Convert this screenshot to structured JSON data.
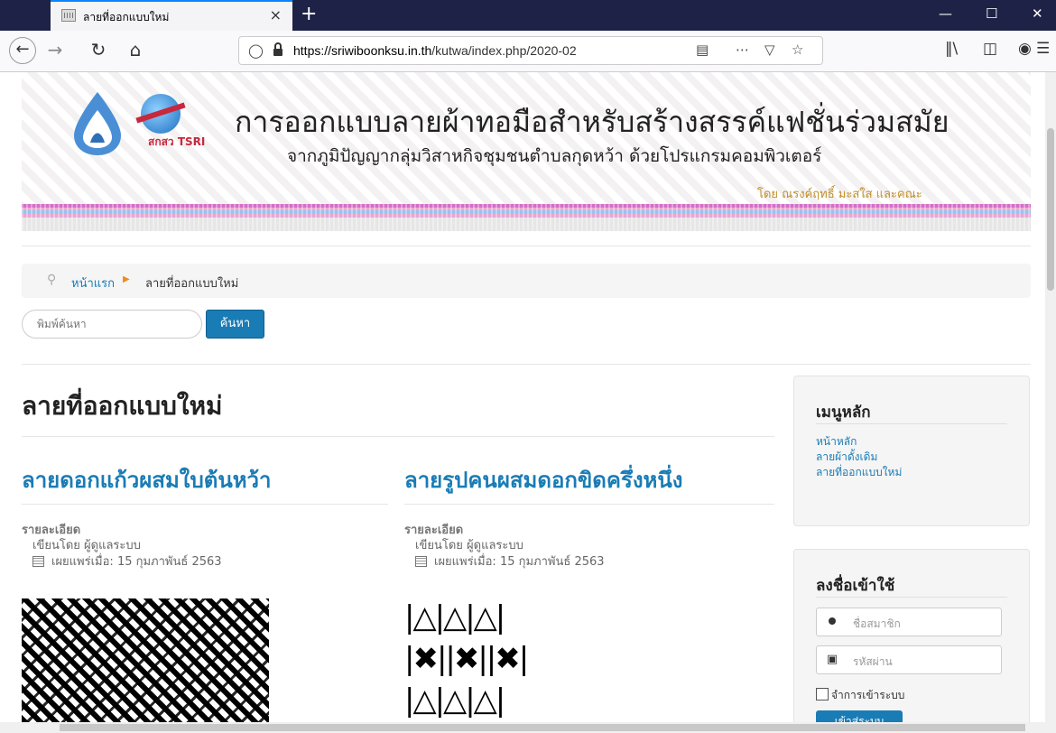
{
  "browser": {
    "tab_title": "ลายที่ออกแบบใหม่",
    "tab_close": "×",
    "new_tab": "+",
    "url_host": "https://sriwiboonksu.in.th",
    "url_path": "/kutwa/index.php/2020-02",
    "icons": [
      "back-icon",
      "forward-icon",
      "reload-icon",
      "home-icon",
      "shield-icon",
      "lock-icon",
      "reader-view-icon",
      "more-icon",
      "pocket-icon",
      "star-icon",
      "library-icon",
      "sidebar-icon",
      "account-icon",
      "menu-icon"
    ]
  },
  "header": {
    "title": "การออกแบบลายผ้าทอมือสำหรับสร้างสรรค์แฟชั่นร่วมสมัย",
    "subtitle": "จากภูมิปัญญากลุ่มวิสาหกิจชุมชนตำบลกุดหว้า ด้วยโปรแกรมคอมพิวเตอร์",
    "author": "โดย ณรงค์ฤทธิ์ มะสใส และคณะ",
    "logo_text": "สกสว TSRI"
  },
  "breadcrumb": {
    "home": "หน้าแรก",
    "current": "ลายที่ออกแบบใหม่"
  },
  "search": {
    "placeholder": "พิมพ์ค้นหา",
    "button": "ค้นหา"
  },
  "main": {
    "page_title": "ลายที่ออกแบบใหม่",
    "articles": [
      {
        "title": "ลายดอกแก้วผสมใบต้นหว้า",
        "detail_label": "รายละเอียด",
        "author": "เขียนโดย ผู้ดูแลระบบ",
        "published": "เผยแพร่เมื่อ: 15 กุมภาพันธ์ 2563"
      },
      {
        "title": "ลายรูปคนผสมดอกขิดครึ่งหนึ่ง",
        "detail_label": "รายละเอียด",
        "author": "เขียนโดย ผู้ดูแลระบบ",
        "published": "เผยแพร่เมื่อ: 15 กุมภาพันธ์ 2563"
      }
    ]
  },
  "sidebar": {
    "menu_title": "เมนูหลัก",
    "menu_items": [
      "หน้าหลัก",
      "ลายผ้าดั้งเดิม",
      "ลายที่ออกแบบใหม่"
    ],
    "login_title": "ลงชื่อเข้าใช้",
    "username_placeholder": "ชื่อสมาชิก",
    "password_placeholder": "รหัสผ่าน",
    "remember": "จำการเข้าระบบ",
    "login_button": "เข้าสู่ระบบ"
  },
  "colors": {
    "link": "#1a7cb5",
    "titlebar": "#1e2246",
    "author": "#c0902a"
  }
}
